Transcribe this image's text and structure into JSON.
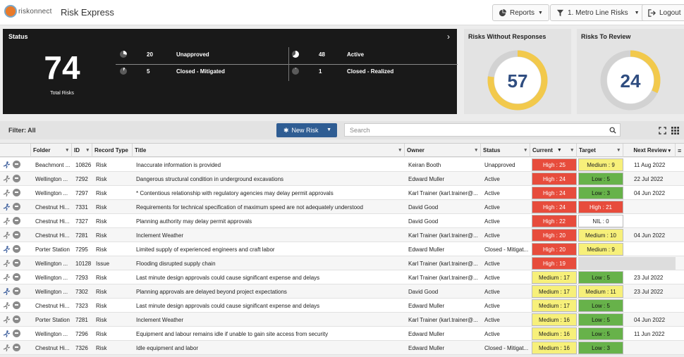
{
  "header": {
    "logo_text": "riskonnect",
    "app_title": "Risk Express",
    "reports_label": "Reports",
    "line_label": "1. Metro Line Risks",
    "logout_label": "Logout"
  },
  "status": {
    "title": "Status",
    "total": "74",
    "total_label": "Total Risks",
    "items": [
      {
        "count": "20",
        "label": "Unapproved",
        "fraction": 0.27
      },
      {
        "count": "48",
        "label": "Active",
        "fraction": 0.65
      },
      {
        "count": "5",
        "label": "Closed - Mitigated",
        "fraction": 0.07
      },
      {
        "count": "1",
        "label": "Closed - Realized",
        "fraction": 0.014
      }
    ]
  },
  "cards": {
    "without_responses": {
      "title": "Risks Without Responses",
      "value": "57",
      "fraction": 0.77
    },
    "to_review": {
      "title": "Risks To Review",
      "value": "24",
      "fraction": 0.32
    }
  },
  "toolbar": {
    "filter_label": "Filter: All",
    "new_risk_label": "New Risk",
    "search_placeholder": "Search"
  },
  "columns": [
    "Folder",
    "ID",
    "Record Type",
    "Title",
    "Owner",
    "Status",
    "Current",
    "Target",
    "Next Review"
  ],
  "rows": [
    {
      "folder": "Beachmont ...",
      "id": "10826",
      "type": "Risk",
      "title": "Inaccurate information is provided",
      "owner": "Keiran Booth",
      "status": "Unapproved",
      "current": "High : 25",
      "current_level": "high",
      "target": "Medium : 9",
      "target_level": "medium",
      "review": "11 Aug 2022"
    },
    {
      "folder": "Wellington ...",
      "id": "7292",
      "type": "Risk",
      "title": "Dangerous structural condition in underground excavations",
      "owner": "Edward Muller",
      "status": "Active",
      "current": "High : 24",
      "current_level": "high",
      "target": "Low : 5",
      "target_level": "low",
      "review": "22 Jul 2022"
    },
    {
      "folder": "Wellington ...",
      "id": "7297",
      "type": "Risk",
      "title": "* Contentious relationship with regulatory agencies may delay permit approvals",
      "owner": "Karl Trainer (karl.trainer@...",
      "status": "Active",
      "current": "High : 24",
      "current_level": "high",
      "target": "Low : 3",
      "target_level": "low",
      "review": "04 Jun 2022"
    },
    {
      "folder": "Chestnut Hi...",
      "id": "7331",
      "type": "Risk",
      "title": "Requirements for technical specification of maximum speed are not adequately understood",
      "owner": "David Good",
      "status": "Active",
      "current": "High : 24",
      "current_level": "high",
      "target": "High : 21",
      "target_level": "high",
      "review": ""
    },
    {
      "folder": "Chestnut Hi...",
      "id": "7327",
      "type": "Risk",
      "title": "Planning authority may delay permit approvals",
      "owner": "David Good",
      "status": "Active",
      "current": "High : 22",
      "current_level": "high",
      "target": "NIL : 0",
      "target_level": "nil",
      "review": ""
    },
    {
      "folder": "Chestnut Hi...",
      "id": "7281",
      "type": "Risk",
      "title": "Inclement Weather",
      "owner": "Karl Trainer (karl.trainer@...",
      "status": "Active",
      "current": "High : 20",
      "current_level": "high",
      "target": "Medium : 10",
      "target_level": "medium",
      "review": "04 Jun 2022"
    },
    {
      "folder": "Porter Station",
      "id": "7295",
      "type": "Risk",
      "title": "Limited supply of experienced engineers and craft labor",
      "owner": "Edward Muller",
      "status": "Closed - Mitigat...",
      "current": "High : 20",
      "current_level": "high",
      "target": "Medium : 9",
      "target_level": "medium",
      "review": ""
    },
    {
      "folder": "Wellington ...",
      "id": "10128",
      "type": "Issue",
      "title": "Flooding disrupted supply chain",
      "owner": "Karl Trainer (karl.trainer@...",
      "status": "Active",
      "current": "High : 19",
      "current_level": "high",
      "target": "",
      "target_level": "empty",
      "review": ""
    },
    {
      "folder": "Wellington ...",
      "id": "7293",
      "type": "Risk",
      "title": "Last minute design approvals could cause significant expense and delays",
      "owner": "Karl Trainer (karl.trainer@...",
      "status": "Active",
      "current": "Medium : 17",
      "current_level": "medium",
      "target": "Low : 5",
      "target_level": "low",
      "review": "23 Jul 2022"
    },
    {
      "folder": "Wellington ...",
      "id": "7302",
      "type": "Risk",
      "title": "Planning approvals are delayed beyond project expectations",
      "owner": "David Good",
      "status": "Active",
      "current": "Medium : 17",
      "current_level": "medium",
      "target": "Medium : 11",
      "target_level": "medium",
      "review": "23 Jul 2022"
    },
    {
      "folder": "Chestnut Hi...",
      "id": "7323",
      "type": "Risk",
      "title": "Last minute design approvals could cause significant expense and delays",
      "owner": "Edward Muller",
      "status": "Active",
      "current": "Medium : 17",
      "current_level": "medium",
      "target": "Low : 5",
      "target_level": "low",
      "review": ""
    },
    {
      "folder": "Porter Station",
      "id": "7281",
      "type": "Risk",
      "title": "Inclement Weather",
      "owner": "Karl Trainer (karl.trainer@...",
      "status": "Active",
      "current": "Medium : 16",
      "current_level": "medium",
      "target": "Low : 5",
      "target_level": "low",
      "review": "04 Jun 2022"
    },
    {
      "folder": "Wellington ...",
      "id": "7296",
      "type": "Risk",
      "title": "Equipment and labour remains idle if unable to gain site access from security",
      "owner": "Edward Muller",
      "status": "Active",
      "current": "Medium : 16",
      "current_level": "medium",
      "target": "Low : 5",
      "target_level": "low",
      "review": "11 Jun 2022"
    },
    {
      "folder": "Chestnut Hi...",
      "id": "7326",
      "type": "Risk",
      "title": "Idle equipment and labor",
      "owner": "Edward Muller",
      "status": "Closed - Mitigat...",
      "current": "Medium : 16",
      "current_level": "medium",
      "target": "Low : 3",
      "target_level": "low",
      "review": ""
    }
  ],
  "colors": {
    "accent": "#2f5d93",
    "high": "#e74c3c",
    "medium": "#f7f07a",
    "low": "#67b24a",
    "donut": "#f2c94c"
  }
}
